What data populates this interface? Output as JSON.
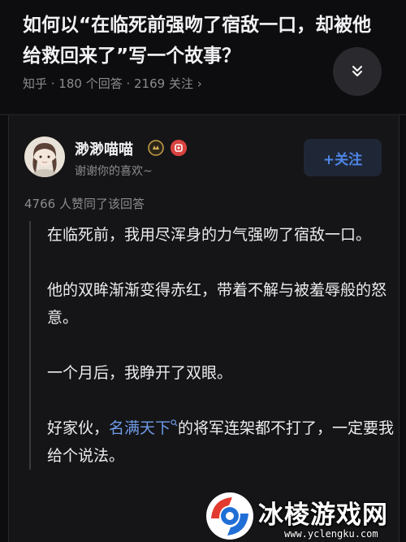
{
  "question": {
    "title": "如何以“在临死前强吻了宿敌一口，却被他给救回来了”写一个故事？",
    "meta": "知乎 · 180 个回答 · 2169 关注 ›"
  },
  "author": {
    "name": "渺渺喵喵",
    "bio": "谢谢你的喜欢~"
  },
  "follow_label": "+关注",
  "votes_text": "4766 人赞同了该回答",
  "content": {
    "p1": "在临死前，我用尽浑身的力气强吻了宿敌一口。",
    "p2": "他的双眸渐渐变得赤红，带着不解与被羞辱般的怒意。",
    "p3": "一个月后，我睁开了双眼。",
    "p4_pre": "好家伙，",
    "p4_link": "名满天下",
    "p4_post": "的将军连架都不打了，一定要我给个说法。"
  },
  "watermark": {
    "title": "冰棱游戏网",
    "url": "www.yclengku.com"
  },
  "icons": {
    "expand": "chevron-double-down-icon",
    "badge1": "gold-medal-icon",
    "badge2": "red-badge-icon",
    "link_search": "search-icon"
  },
  "colors": {
    "background": "#0d0d0f",
    "card": "#151517",
    "accent": "#4f86e8",
    "link": "#6f9be8",
    "muted": "#8b8b90"
  }
}
